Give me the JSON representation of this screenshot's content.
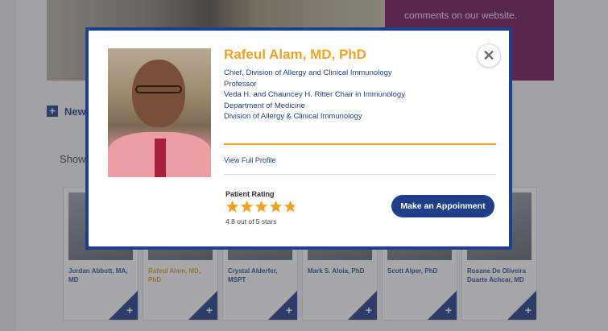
{
  "background": {
    "hero_text": "comments on our website.",
    "new_label": "New",
    "showing_label": "Show",
    "cards": [
      {
        "name": "Jordan Abbott, MA, MD",
        "highlight": false
      },
      {
        "name": "Rafeul Alam, MD, PhD",
        "highlight": true
      },
      {
        "name": "Crystal Alderfer, MSPT",
        "highlight": false
      },
      {
        "name": "Mark S. Aloia, PhD",
        "highlight": false
      },
      {
        "name": "Scott Alper, PhD",
        "highlight": false
      },
      {
        "name": "Rosane De Oliveira Duarte Achcar, MD",
        "highlight": false
      }
    ]
  },
  "modal": {
    "name": "Rafeul Alam, MD, PhD",
    "titles": [
      "Chief, Division of Allergy and Clinical Immunology",
      "Professor",
      "Veda H. and Chauncey H. Ritter Chair in Immunology",
      "Department of Medicine",
      "Division of Allergy & Clinical Immunology"
    ],
    "close_glyph": "✕",
    "view_profile": "View Full Profile",
    "rating_label": "Patient Rating",
    "rating_value": 4.8,
    "rating_max": 5,
    "rating_text": "4.8 out of 5 stars",
    "appointment_button": "Make an Appoinment"
  },
  "colors": {
    "brand_blue": "#1f3f8a",
    "accent_gold": "#f0a225",
    "link_blue": "#24448a",
    "hero_purple": "#70155a"
  },
  "icons": {
    "close": "close-icon",
    "star": "star-icon",
    "plus": "plus-icon"
  }
}
